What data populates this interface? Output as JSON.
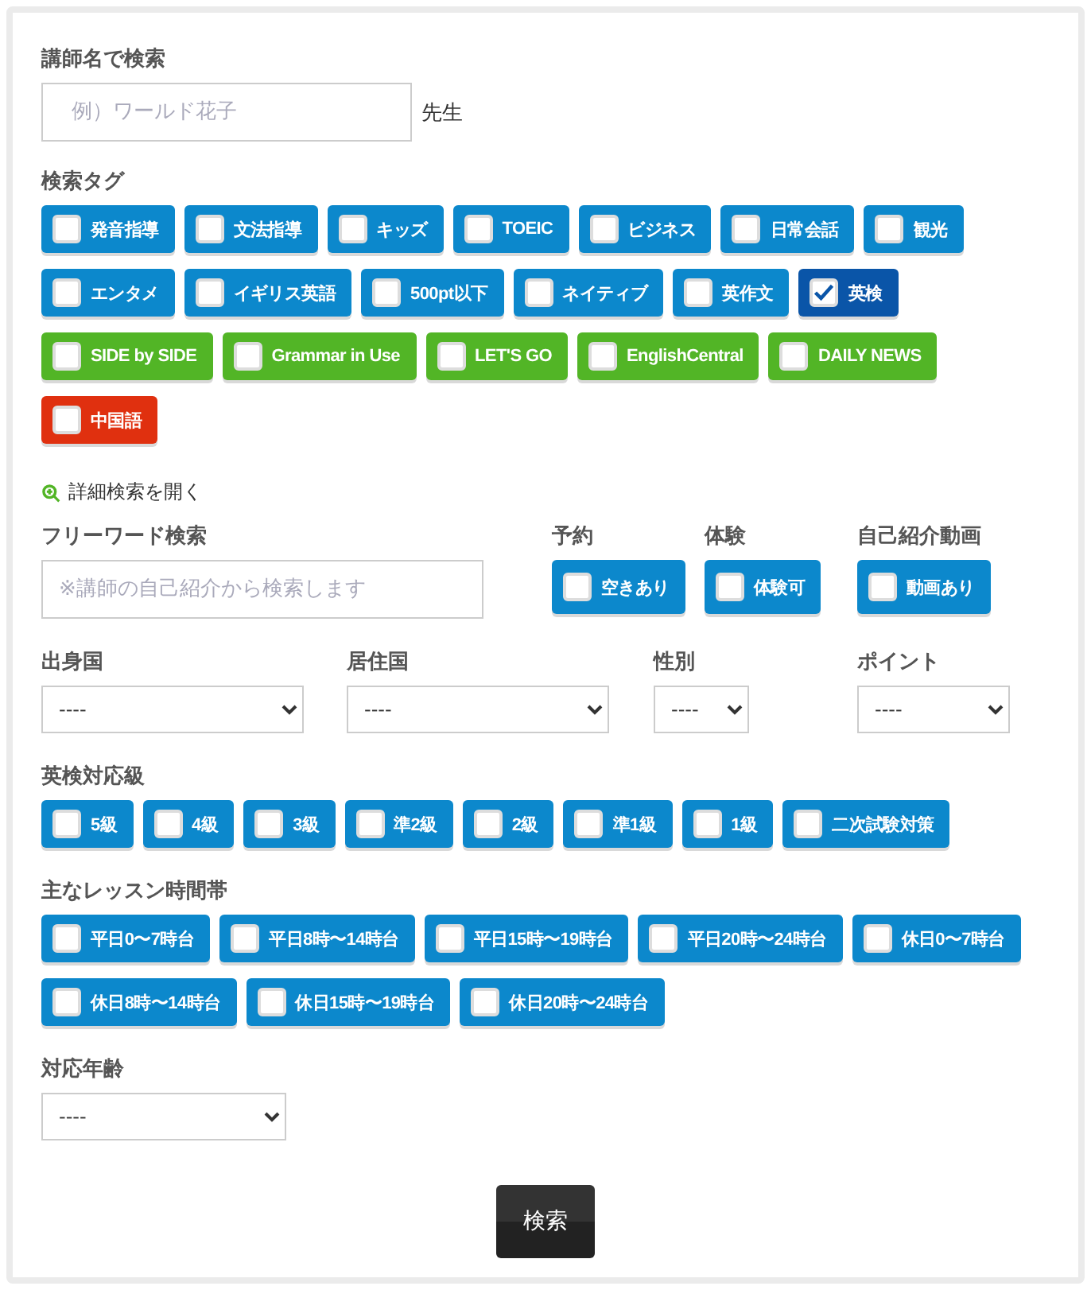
{
  "teacher_search": {
    "label": "講師名で検索",
    "placeholder": "例）ワールド花子",
    "suffix": "先生"
  },
  "tags": {
    "label": "検索タグ",
    "items": [
      {
        "text": "発音指導",
        "checked": false,
        "color": "#0c88cc"
      },
      {
        "text": "文法指導",
        "checked": false,
        "color": "#0c88cc"
      },
      {
        "text": "キッズ",
        "checked": false,
        "color": "#0c88cc"
      },
      {
        "text": "TOEIC",
        "checked": false,
        "color": "#0c88cc"
      },
      {
        "text": "ビジネス",
        "checked": false,
        "color": "#0c88cc"
      },
      {
        "text": "日常会話",
        "checked": false,
        "color": "#0c88cc"
      },
      {
        "text": "観光",
        "checked": false,
        "color": "#0c88cc"
      },
      {
        "text": "エンタメ",
        "checked": false,
        "color": "#0c88cc"
      },
      {
        "text": "イギリス英語",
        "checked": false,
        "color": "#0c88cc"
      },
      {
        "text": "500pt以下",
        "checked": false,
        "color": "#0c88cc"
      },
      {
        "text": "ネイティブ",
        "checked": false,
        "color": "#0c88cc"
      },
      {
        "text": "英作文",
        "checked": false,
        "color": "#0c88cc"
      },
      {
        "text": "英検",
        "checked": true,
        "color": "#0a55a8"
      },
      {
        "text": "SIDE by SIDE",
        "checked": false,
        "color": "#52b526"
      },
      {
        "text": "Grammar in Use",
        "checked": false,
        "color": "#52b526"
      },
      {
        "text": "LET'S GO",
        "checked": false,
        "color": "#52b526"
      },
      {
        "text": "EnglishCentral",
        "checked": false,
        "color": "#52b526"
      },
      {
        "text": "DAILY NEWS",
        "checked": false,
        "color": "#52b526"
      },
      {
        "text": "中国語",
        "checked": false,
        "color": "#e0300f"
      }
    ]
  },
  "detail_link": "詳細検索を開く",
  "free_word": {
    "label": "フリーワード検索",
    "placeholder": "※講師の自己紹介から検索します"
  },
  "option_groups": [
    {
      "label": "予約",
      "option": {
        "text": "空きあり",
        "checked": false
      }
    },
    {
      "label": "体験",
      "option": {
        "text": "体験可",
        "checked": false
      }
    },
    {
      "label": "自己紹介動画",
      "option": {
        "text": "動画あり",
        "checked": false
      }
    }
  ],
  "selects": [
    {
      "label": "出身国",
      "value": "----"
    },
    {
      "label": "居住国",
      "value": "----"
    },
    {
      "label": "性別",
      "value": "----"
    },
    {
      "label": "ポイント",
      "value": "----"
    }
  ],
  "eiken": {
    "label": "英検対応級",
    "items": [
      {
        "text": "5級",
        "checked": false
      },
      {
        "text": "4級",
        "checked": false
      },
      {
        "text": "3級",
        "checked": false
      },
      {
        "text": "準2級",
        "checked": false
      },
      {
        "text": "2級",
        "checked": false
      },
      {
        "text": "準1級",
        "checked": false
      },
      {
        "text": "1級",
        "checked": false
      },
      {
        "text": "二次試験対策",
        "checked": false
      }
    ]
  },
  "lesson_times": {
    "label": "主なレッスン時間帯",
    "items": [
      {
        "text": "平日0〜7時台",
        "checked": false
      },
      {
        "text": "平日8時〜14時台",
        "checked": false
      },
      {
        "text": "平日15時〜19時台",
        "checked": false
      },
      {
        "text": "平日20時〜24時台",
        "checked": false
      },
      {
        "text": "休日0〜7時台",
        "checked": false
      },
      {
        "text": "休日8時〜14時台",
        "checked": false
      },
      {
        "text": "休日15時〜19時台",
        "checked": false
      },
      {
        "text": "休日20時〜24時台",
        "checked": false
      }
    ]
  },
  "age": {
    "label": "対応年齢",
    "value": "----"
  },
  "search_button": "検索"
}
